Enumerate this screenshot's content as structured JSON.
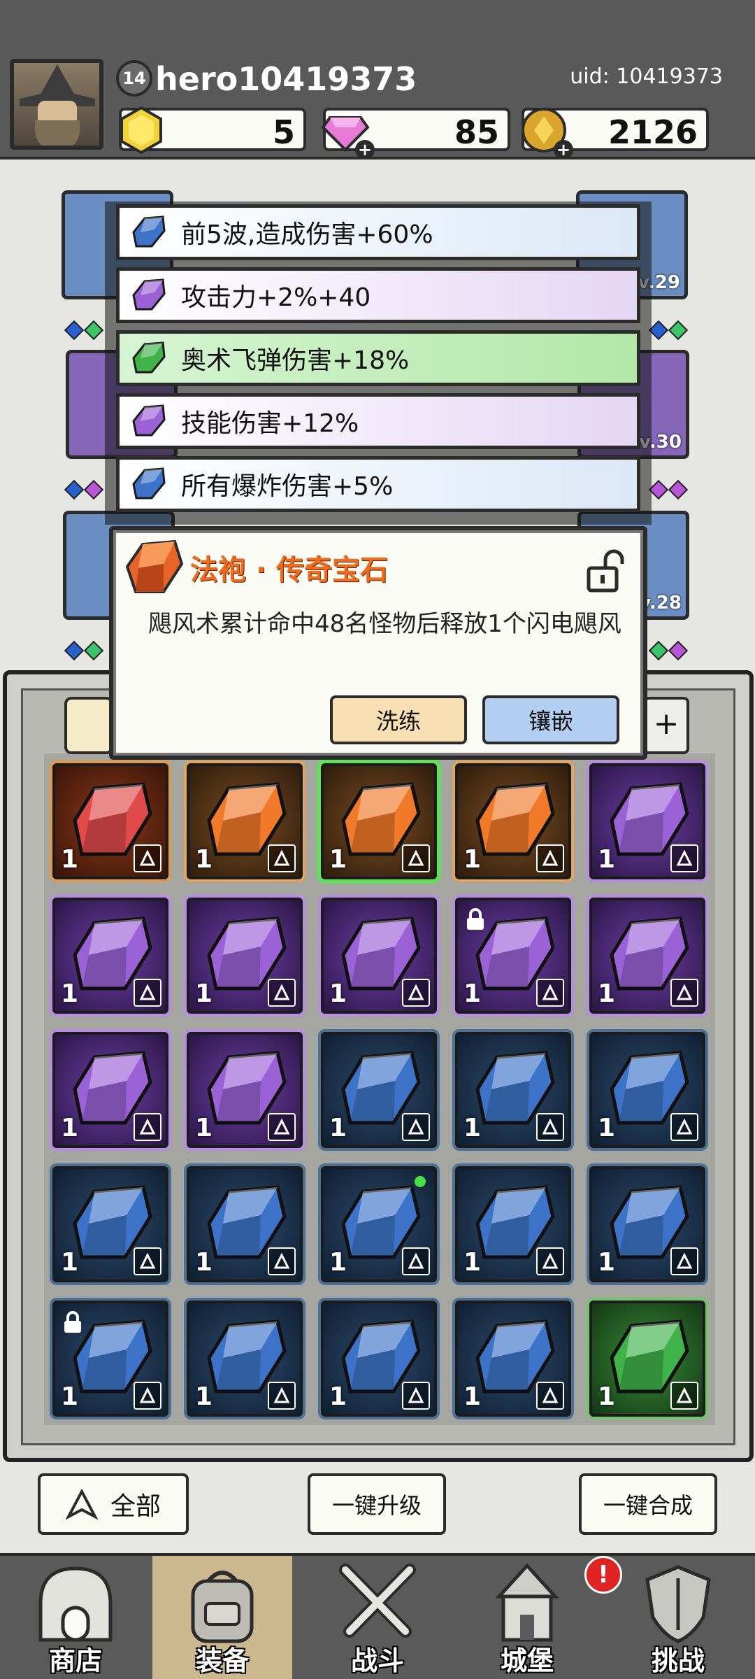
{
  "header": {
    "level": "14",
    "username": "hero10419373",
    "uid": "uid: 10419373",
    "currencies": [
      {
        "name": "gold-gem",
        "value": "5"
      },
      {
        "name": "diamond",
        "value": "85"
      },
      {
        "name": "coin",
        "value": "2126"
      }
    ]
  },
  "equipment_slots": [
    {
      "level": "Lv.29"
    },
    {
      "level": "Lv.30"
    },
    {
      "level": "Lv.28"
    }
  ],
  "affixes": [
    {
      "text": "前5波,造成伤害+60%",
      "quality": "blue"
    },
    {
      "text": "攻击力+2%+40",
      "quality": "purple"
    },
    {
      "text": "奥术飞弹伤害+18%",
      "quality": "green"
    },
    {
      "text": "技能伤害+12%",
      "quality": "purple"
    },
    {
      "text": "所有爆炸伤害+5%",
      "quality": "blue"
    }
  ],
  "dialog": {
    "title": "法袍 · 传奇宝石",
    "description": "飓风术累计命中48名怪物后释放1个闪电飓风",
    "refine_label": "洗练",
    "inlay_label": "镶嵌"
  },
  "filter": {
    "add_label": "+"
  },
  "inventory": [
    [
      {
        "q": "red",
        "c": "1"
      },
      {
        "q": "orange",
        "c": "1"
      },
      {
        "q": "orange",
        "c": "1",
        "sel": true
      },
      {
        "q": "orange",
        "c": "1"
      },
      {
        "q": "purple",
        "c": "1"
      }
    ],
    [
      {
        "q": "purple",
        "c": "1"
      },
      {
        "q": "purple",
        "c": "1"
      },
      {
        "q": "purple",
        "c": "1"
      },
      {
        "q": "purple",
        "c": "1",
        "lock": true
      },
      {
        "q": "purple",
        "c": "1"
      }
    ],
    [
      {
        "q": "purple",
        "c": "1"
      },
      {
        "q": "purple",
        "c": "1"
      },
      {
        "q": "blue",
        "c": "1"
      },
      {
        "q": "blue",
        "c": "1"
      },
      {
        "q": "blue",
        "c": "1"
      }
    ],
    [
      {
        "q": "blue",
        "c": "1"
      },
      {
        "q": "blue",
        "c": "1"
      },
      {
        "q": "blue",
        "c": "1",
        "dot": true
      },
      {
        "q": "blue",
        "c": "1"
      },
      {
        "q": "blue",
        "c": "1"
      }
    ],
    [
      {
        "q": "blue",
        "c": "1",
        "lock": true
      },
      {
        "q": "blue",
        "c": "1"
      },
      {
        "q": "blue",
        "c": "1"
      },
      {
        "q": "blue",
        "c": "1"
      },
      {
        "q": "green",
        "c": "1"
      }
    ]
  ],
  "actions": {
    "filter_all": "全部",
    "upgrade_all": "一键升级",
    "merge_all": "一键合成"
  },
  "nav": {
    "shop": "商店",
    "equipment": "装备",
    "battle": "战斗",
    "castle": "城堡",
    "challenge": "挑战",
    "alert": "!"
  },
  "colors": {
    "red": "#e04a4a",
    "orange": "#f07a2a",
    "purple": "#9b62d8",
    "blue": "#3c73c8",
    "green": "#3fb24a"
  }
}
